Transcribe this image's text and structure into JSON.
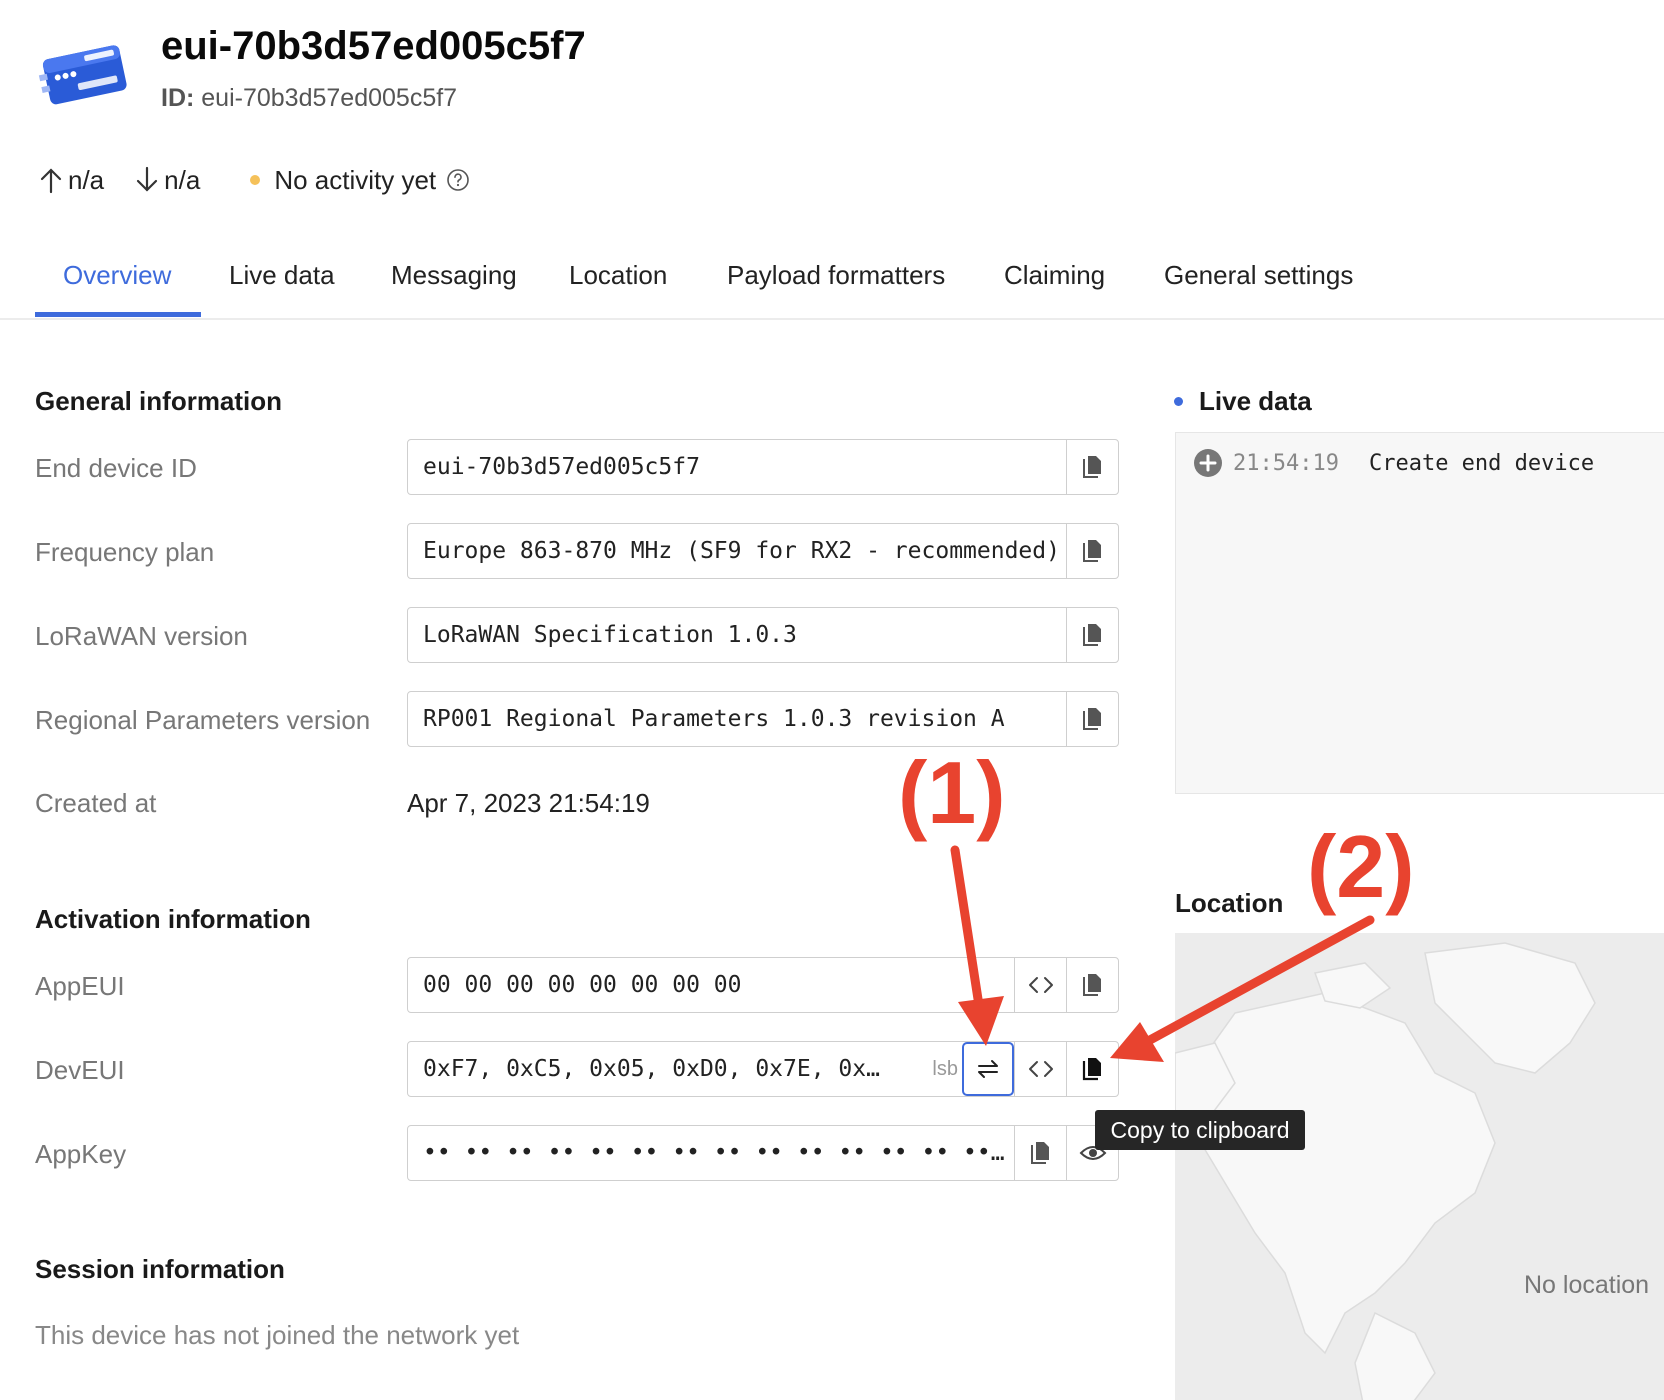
{
  "device": {
    "title": "eui-70b3d57ed005c5f7",
    "id_label": "ID:",
    "id_value": "eui-70b3d57ed005c5f7",
    "uplink": "n/a",
    "downlink": "n/a",
    "activity": "No activity yet"
  },
  "tabs": [
    {
      "label": "Overview",
      "active": true
    },
    {
      "label": "Live data"
    },
    {
      "label": "Messaging"
    },
    {
      "label": "Location"
    },
    {
      "label": "Payload formatters"
    },
    {
      "label": "Claiming"
    },
    {
      "label": "General settings"
    }
  ],
  "general": {
    "title": "General information",
    "end_device_id": {
      "label": "End device ID",
      "value": "eui-70b3d57ed005c5f7"
    },
    "frequency_plan": {
      "label": "Frequency plan",
      "value": "Europe 863-870 MHz (SF9 for RX2 - recommended)"
    },
    "lorawan_version": {
      "label": "LoRaWAN version",
      "value": "LoRaWAN Specification 1.0.3"
    },
    "regional_params": {
      "label": "Regional Parameters version",
      "value": "RP001 Regional Parameters 1.0.3 revision A"
    },
    "created_at": {
      "label": "Created at",
      "value": "Apr 7, 2023 21:54:19"
    }
  },
  "activation": {
    "title": "Activation information",
    "app_eui": {
      "label": "AppEUI",
      "value": "00 00 00 00 00 00 00 00"
    },
    "dev_eui": {
      "label": "DevEUI",
      "value": "0xF7, 0xC5, 0x05, 0xD0, 0x7E, 0x…",
      "byte_order_tag": "lsb"
    },
    "app_key": {
      "label": "AppKey",
      "value": "•• •• •• •• •• •• •• •• •• •• •• •• •• •• •• ••"
    }
  },
  "session": {
    "title": "Session information",
    "message": "This device has not joined the network yet"
  },
  "live_data": {
    "title": "Live data",
    "events": [
      {
        "time": "21:54:19",
        "text": "Create end device"
      }
    ]
  },
  "location": {
    "title": "Location",
    "empty_text": "No location"
  },
  "tooltip": "Copy to clipboard",
  "annotations": {
    "label_1": "(1)",
    "label_2": "(2)",
    "color": "#e8432f"
  },
  "colors": {
    "accent": "#3e6bdc",
    "activity_dot": "#f5c15a",
    "logo_blue": "#2a5bd7"
  },
  "icons": {
    "uplink": "arrow-up-icon",
    "downlink": "arrow-down-icon",
    "help": "question-circle-icon",
    "copy": "copy-icon",
    "code": "code-brackets-icon",
    "swap": "swap-arrows-icon",
    "eye": "eye-icon",
    "add_event": "plus-circle-icon"
  }
}
